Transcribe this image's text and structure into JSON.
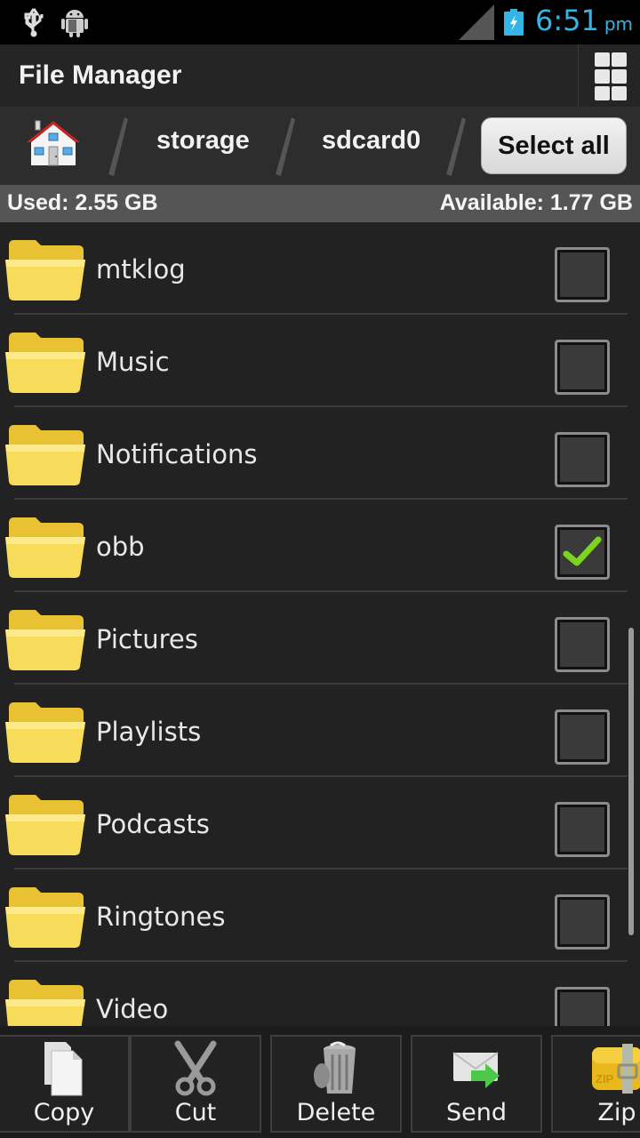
{
  "status_bar": {
    "time": "6:51",
    "ampm": "pm",
    "clock_color": "#33b5e5",
    "icons": [
      "usb-icon",
      "android-debug-icon",
      "signal-icon",
      "battery-charging-icon"
    ]
  },
  "title_bar": {
    "title": "File Manager",
    "view_toggle_icon": "grid-view-icon"
  },
  "breadcrumb": {
    "home_icon": "home-icon",
    "items": [
      "storage",
      "sdcard0"
    ],
    "select_all_label": "Select all"
  },
  "storage": {
    "used": "Used: 2.55 GB",
    "available": "Available: 1.77 GB"
  },
  "files": [
    {
      "name": "mtklog",
      "type": "folder",
      "checked": false
    },
    {
      "name": "Music",
      "type": "folder",
      "checked": false
    },
    {
      "name": "Notifications",
      "type": "folder",
      "checked": false
    },
    {
      "name": "obb",
      "type": "folder",
      "checked": true
    },
    {
      "name": "Pictures",
      "type": "folder",
      "checked": false
    },
    {
      "name": "Playlists",
      "type": "folder",
      "checked": false
    },
    {
      "name": "Podcasts",
      "type": "folder",
      "checked": false
    },
    {
      "name": "Ringtones",
      "type": "folder",
      "checked": false
    },
    {
      "name": "Video",
      "type": "folder",
      "checked": false
    }
  ],
  "toolbar": {
    "buttons": [
      {
        "label": "Copy",
        "icon": "copy-icon"
      },
      {
        "label": "Cut",
        "icon": "scissors-icon"
      },
      {
        "label": "Delete",
        "icon": "trash-icon"
      },
      {
        "label": "Send",
        "icon": "send-icon"
      },
      {
        "label": "Zip",
        "icon": "zip-icon"
      }
    ]
  },
  "colors": {
    "checkmark": "#7ed321",
    "folder": "#f5d44a"
  }
}
